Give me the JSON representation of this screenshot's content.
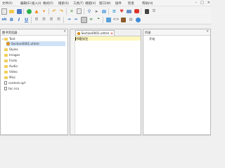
{
  "menu": [
    {
      "label": "文件(F)"
    },
    {
      "label": "编辑(E)"
    },
    {
      "label": "插入(I)"
    },
    {
      "label": "格式(F)"
    },
    {
      "label": "搜索(S)"
    },
    {
      "label": "工具(T)"
    },
    {
      "label": "视图(V)"
    },
    {
      "label": "窗口(W)"
    },
    {
      "label": "插件"
    },
    {
      "label": "检查"
    },
    {
      "label": "帮助(H)"
    }
  ],
  "window_controls": {
    "minimize": "–",
    "maximize": "□",
    "close": "✕"
  },
  "toolbar": {
    "icons_row1": [
      "new-book",
      "folder-open",
      "save",
      "add-circle",
      "arrow-up",
      "arrow-down",
      "undo",
      "redo",
      "cut",
      "find",
      "replace",
      "tag",
      "heart",
      "mail",
      "puzzle"
    ],
    "icons_row2": [
      "spellcheck",
      "bold",
      "italic",
      "underline",
      "align-left",
      "align-center",
      "align-right",
      "list",
      "indent",
      "outdent",
      "table",
      "link",
      "quote",
      "image",
      "code",
      "book",
      "settings",
      "help"
    ]
  },
  "book_browser": {
    "title": "图书浏览器",
    "close": "✕",
    "items": [
      {
        "label": "Text",
        "type": "folder",
        "expanded": true
      },
      {
        "label": "Section0001.xhtml",
        "type": "xhtml"
      },
      {
        "label": "Styles",
        "type": "folder"
      },
      {
        "label": "Images",
        "type": "folder"
      },
      {
        "label": "Fonts",
        "type": "folder"
      },
      {
        "label": "Audio",
        "type": "folder"
      },
      {
        "label": "Video",
        "type": "folder"
      },
      {
        "label": "Misc",
        "type": "folder"
      },
      {
        "label": "content.opf",
        "type": "file"
      },
      {
        "label": "toc.ncx",
        "type": "file"
      }
    ]
  },
  "editor": {
    "tab_label": "Section0001.xhtml",
    "tab_close": "⊠",
    "line1_text": "书籍加注"
  },
  "toc": {
    "title": "目录",
    "close": "✕",
    "items": [
      {
        "label": "开始"
      }
    ]
  }
}
